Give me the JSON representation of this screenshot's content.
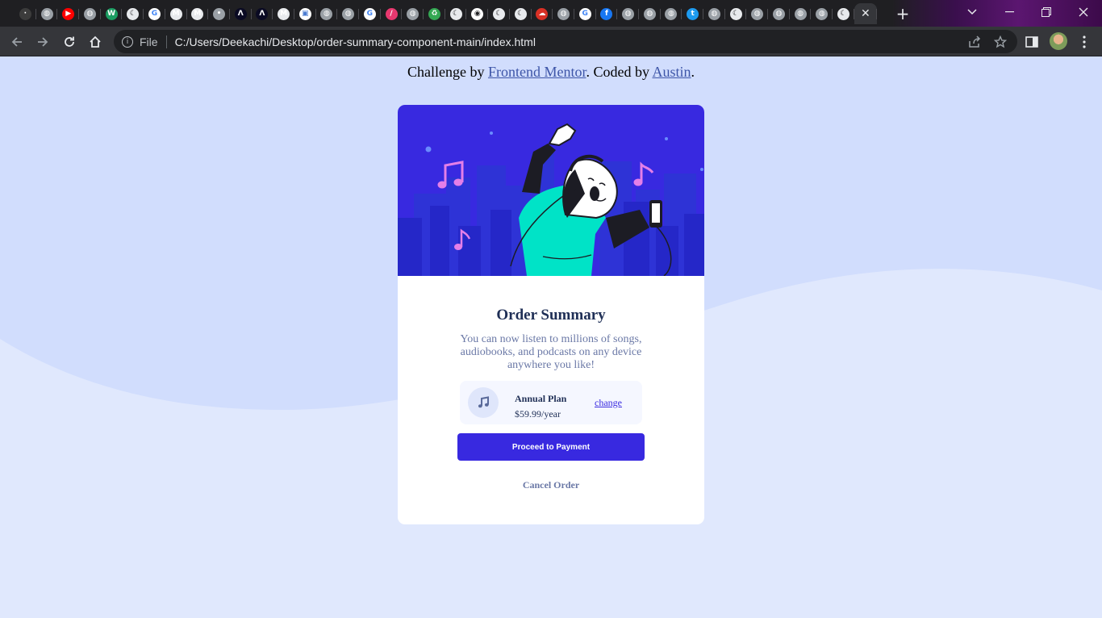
{
  "browser": {
    "tabs": [
      {
        "icon": "dark-tab-icon",
        "color": "#3c3c3c"
      },
      {
        "icon": "globe-icon",
        "color": "#9aa0a6"
      },
      {
        "icon": "youtube-music-icon",
        "color": "#ff0000"
      },
      {
        "icon": "globe-icon",
        "color": "#9aa0a6"
      },
      {
        "icon": "w-logo-icon",
        "color": "#1b9d62"
      },
      {
        "icon": "moon-icon",
        "color": "#e8eaed"
      },
      {
        "icon": "google-icon",
        "color": "#ffffff"
      },
      {
        "icon": "m-logo-icon",
        "color": "#e8eaed"
      },
      {
        "icon": "m-logo-icon",
        "color": "#e8eaed"
      },
      {
        "icon": "apple-icon",
        "color": "#9aa0a6"
      },
      {
        "icon": "code-icon",
        "color": "#0a0a23"
      },
      {
        "icon": "code-icon",
        "color": "#0a0a23"
      },
      {
        "icon": "m-logo-icon",
        "color": "#e8eaed"
      },
      {
        "icon": "image-icon",
        "color": "#ffffff"
      },
      {
        "icon": "globe-icon",
        "color": "#9aa0a6"
      },
      {
        "icon": "globe-icon",
        "color": "#9aa0a6"
      },
      {
        "icon": "google-icon",
        "color": "#ffffff"
      },
      {
        "icon": "stripes-icon",
        "color": "#e8386f"
      },
      {
        "icon": "globe-icon",
        "color": "#9aa0a6"
      },
      {
        "icon": "recycle-icon",
        "color": "#34a853"
      },
      {
        "icon": "moon-icon",
        "color": "#e8eaed"
      },
      {
        "icon": "github-icon",
        "color": "#ffffff"
      },
      {
        "icon": "moon-icon",
        "color": "#e8eaed"
      },
      {
        "icon": "moon-icon",
        "color": "#e8eaed"
      },
      {
        "icon": "cloud-icon",
        "color": "#d93025"
      },
      {
        "icon": "globe-icon",
        "color": "#9aa0a6"
      },
      {
        "icon": "google-icon",
        "color": "#ffffff"
      },
      {
        "icon": "facebook-icon",
        "color": "#1877f2"
      },
      {
        "icon": "globe-icon",
        "color": "#9aa0a6"
      },
      {
        "icon": "globe-icon",
        "color": "#9aa0a6"
      },
      {
        "icon": "globe-icon",
        "color": "#9aa0a6"
      },
      {
        "icon": "twitter-icon",
        "color": "#1d9bf0"
      },
      {
        "icon": "globe-icon",
        "color": "#9aa0a6"
      },
      {
        "icon": "moon-icon",
        "color": "#e8eaed"
      },
      {
        "icon": "globe-icon",
        "color": "#9aa0a6"
      },
      {
        "icon": "globe-icon",
        "color": "#9aa0a6"
      },
      {
        "icon": "globe-icon",
        "color": "#9aa0a6"
      },
      {
        "icon": "globe-icon",
        "color": "#9aa0a6"
      },
      {
        "icon": "moon-icon",
        "color": "#e8eaed"
      }
    ],
    "active_tab_close": "✕",
    "new_tab": "+",
    "address": {
      "file_label": "File",
      "url": "C:/Users/Deekachi/Desktop/order-summary-component-main/index.html"
    }
  },
  "page": {
    "credit": {
      "prefix": "Challenge by ",
      "link1": "Frontend Mentor",
      "middle": ". Coded by ",
      "link2": "Austin",
      "suffix": "."
    },
    "card": {
      "title": "Order Summary",
      "description": "You can now listen to millions of songs, audiobooks, and podcasts on any device anywhere you like!",
      "plan_name": "Annual Plan",
      "plan_price": "$59.99/year",
      "change_label": "change",
      "pay_label": "Proceed to Payment",
      "cancel_label": "Cancel Order"
    },
    "colors": {
      "background": "#e0e8fd",
      "wave": "#d1ddfd",
      "hero": "#3829e0",
      "primary_button": "#3829e0",
      "title": "#1f2f56",
      "muted": "#6a78a6"
    }
  }
}
